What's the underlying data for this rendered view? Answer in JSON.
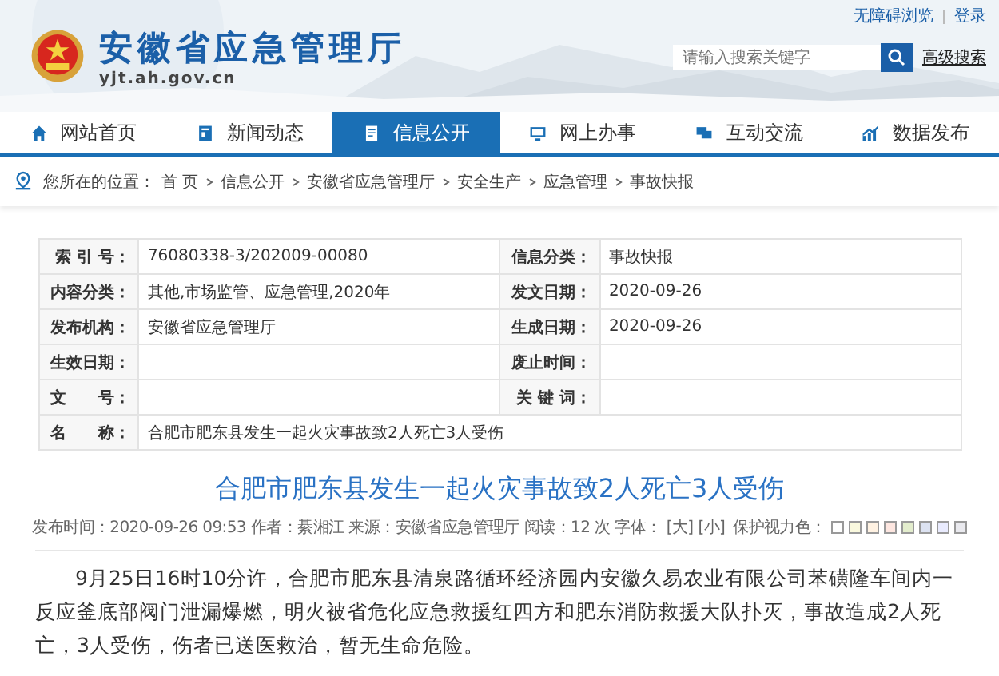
{
  "header": {
    "site_name": "安徽省应急管理厅",
    "domain": "yjt.ah.gov.cn",
    "links": [
      "无障碍浏览",
      "登录"
    ],
    "search": {
      "placeholder": "请输入搜索关键字"
    },
    "advanced_search": "高级搜索"
  },
  "nav": [
    {
      "label": "网站首页",
      "selected": false
    },
    {
      "label": "新闻动态",
      "selected": false
    },
    {
      "label": "信息公开",
      "selected": true
    },
    {
      "label": "网上办事",
      "selected": false
    },
    {
      "label": "互动交流",
      "selected": false
    },
    {
      "label": "数据发布",
      "selected": false
    }
  ],
  "breadcrumb": {
    "prefix": "您所在的位置：",
    "items": [
      "首 页",
      "信息公开",
      "安徽省应急管理厅",
      "安全生产",
      "应急管理",
      "事故快报"
    ]
  },
  "info_table": [
    [
      {
        "label": "索 引 号：",
        "value": "76080338-3/202009-00080"
      },
      {
        "label": "信息分类：",
        "value": "事故快报"
      }
    ],
    [
      {
        "label": "内容分类：",
        "value": "其他,市场监管、应急管理,2020年"
      },
      {
        "label": "发文日期：",
        "value": "2020-09-26"
      }
    ],
    [
      {
        "label": "发布机构：",
        "value": "安徽省应急管理厅"
      },
      {
        "label": "生成日期：",
        "value": "2020-09-26"
      }
    ],
    [
      {
        "label": "生效日期："
      },
      {
        "label": "废止时间："
      }
    ],
    [
      {
        "label": "文　　号："
      },
      {
        "label": "关 键 词："
      }
    ],
    [
      {
        "label": "名　　称：",
        "value": "合肥市肥东县发生一起火灾事故致2人死亡3人受伤"
      }
    ]
  ],
  "article": {
    "title": "合肥市肥东县发生一起火灾事故致2人死亡3人受伤",
    "meta": [
      "发布时间：2020-09-26 09:53",
      "作者：綦湘江",
      "来源：安徽省应急管理厅",
      "阅读：12 次"
    ],
    "font_label": "字体：",
    "font_sizes": [
      "[大]",
      "[小]"
    ],
    "eye_label": "保护视力色：",
    "eye_colors": [
      {
        "color": "#ffffff"
      },
      {
        "color": "#faf9de"
      },
      {
        "color": "#fff2e2"
      },
      {
        "color": "#fde6e0"
      },
      {
        "color": "#e3edcd"
      },
      {
        "color": "#dce2f1"
      },
      {
        "color": "#e9ebfe"
      },
      {
        "color": "#eaeaef"
      }
    ],
    "body": "9月25日16时10分许，合肥市肥东县清泉路循环经济园内安徽久易农业有限公司苯磺隆车间内一反应釜底部阀门泄漏爆燃，明火被省危化应急救援红四方和肥东消防救援大队扑灭，事故造成2人死亡，3人受伤，伤者已送医救治，暂无生命危险。"
  }
}
